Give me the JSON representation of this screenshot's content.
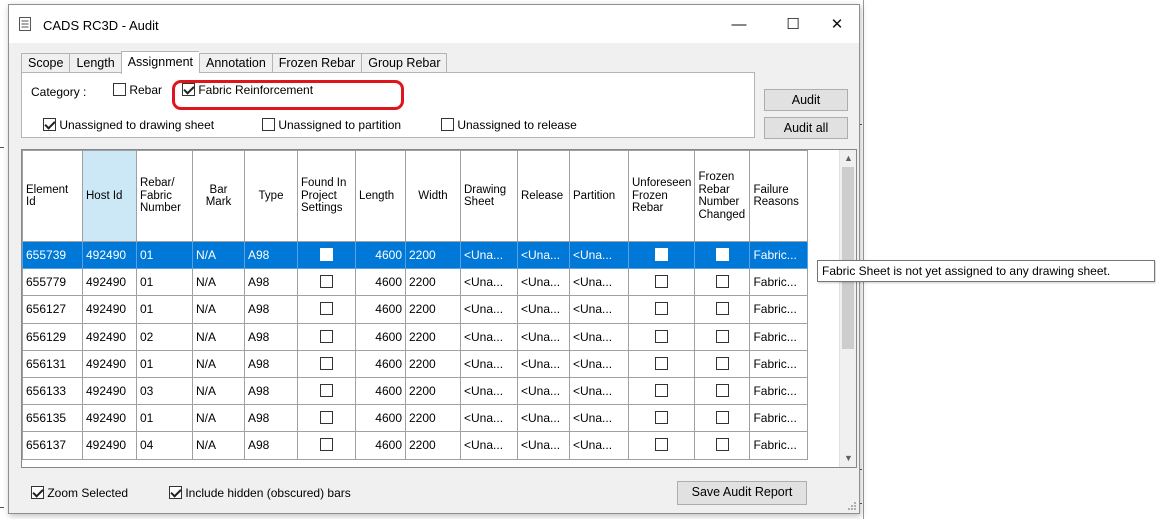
{
  "window": {
    "title": "CADS RC3D - Audit",
    "controls": [
      "—",
      "☐",
      "✕"
    ]
  },
  "tabs": [
    {
      "label": "Scope",
      "active": false
    },
    {
      "label": "Length",
      "active": false
    },
    {
      "label": "Assignment",
      "active": true
    },
    {
      "label": "Annotation",
      "active": false
    },
    {
      "label": "Frozen Rebar",
      "active": false
    },
    {
      "label": "Group Rebar",
      "active": false
    }
  ],
  "category": {
    "label": "Category :",
    "rebar": {
      "label": "Rebar",
      "checked": false
    },
    "fabric": {
      "label": "Fabric Reinforcement",
      "checked": true
    }
  },
  "filters": {
    "unassigned_sheet": {
      "label": "Unassigned to drawing sheet",
      "checked": true
    },
    "unassigned_partition": {
      "label": "Unassigned to partition",
      "checked": false
    },
    "unassigned_release": {
      "label": "Unassigned to release",
      "checked": false
    }
  },
  "buttons": {
    "audit": "Audit",
    "audit_all": "Audit all",
    "save_report": "Save Audit Report"
  },
  "grid": {
    "columns": [
      "Element Id",
      "Host Id",
      "Rebar/ Fabric Number",
      "Bar Mark",
      "Type",
      "Found In Project Settings",
      "Length",
      "Width",
      "Drawing Sheet",
      "Release",
      "Partition",
      "Unforeseen Frozen Rebar",
      "Frozen Rebar Number Changed",
      "Failure Reasons"
    ],
    "rows": [
      {
        "element": "655739",
        "host": "492490",
        "number": "01",
        "mark": "N/A",
        "type": "A98",
        "length": "4600",
        "width": "2200",
        "sheet": "<Una...",
        "release": "<Una...",
        "partition": "<Una...",
        "failure": "Fabric..."
      },
      {
        "element": "655779",
        "host": "492490",
        "number": "01",
        "mark": "N/A",
        "type": "A98",
        "length": "4600",
        "width": "2200",
        "sheet": "<Una...",
        "release": "<Una...",
        "partition": "<Una...",
        "failure": "Fabric..."
      },
      {
        "element": "656127",
        "host": "492490",
        "number": "01",
        "mark": "N/A",
        "type": "A98",
        "length": "4600",
        "width": "2200",
        "sheet": "<Una...",
        "release": "<Una...",
        "partition": "<Una...",
        "failure": "Fabric..."
      },
      {
        "element": "656129",
        "host": "492490",
        "number": "02",
        "mark": "N/A",
        "type": "A98",
        "length": "4600",
        "width": "2200",
        "sheet": "<Una...",
        "release": "<Una...",
        "partition": "<Una...",
        "failure": "Fabric..."
      },
      {
        "element": "656131",
        "host": "492490",
        "number": "01",
        "mark": "N/A",
        "type": "A98",
        "length": "4600",
        "width": "2200",
        "sheet": "<Una...",
        "release": "<Una...",
        "partition": "<Una...",
        "failure": "Fabric..."
      },
      {
        "element": "656133",
        "host": "492490",
        "number": "03",
        "mark": "N/A",
        "type": "A98",
        "length": "4600",
        "width": "2200",
        "sheet": "<Una...",
        "release": "<Una...",
        "partition": "<Una...",
        "failure": "Fabric..."
      },
      {
        "element": "656135",
        "host": "492490",
        "number": "01",
        "mark": "N/A",
        "type": "A98",
        "length": "4600",
        "width": "2200",
        "sheet": "<Una...",
        "release": "<Una...",
        "partition": "<Una...",
        "failure": "Fabric..."
      },
      {
        "element": "656137",
        "host": "492490",
        "number": "04",
        "mark": "N/A",
        "type": "A98",
        "length": "4600",
        "width": "2200",
        "sheet": "<Una...",
        "release": "<Una...",
        "partition": "<Una...",
        "failure": "Fabric..."
      }
    ]
  },
  "tooltip": "Fabric Sheet is not yet assigned to any drawing sheet.",
  "bottom": {
    "zoom_selected": {
      "label": "Zoom Selected",
      "checked": true
    },
    "include_hidden": {
      "label": "Include hidden (obscured) bars",
      "checked": true
    }
  },
  "colors": {
    "selection": "#0078d7",
    "highlight": "#e0141b",
    "sorted_header": "#cce8f7"
  }
}
